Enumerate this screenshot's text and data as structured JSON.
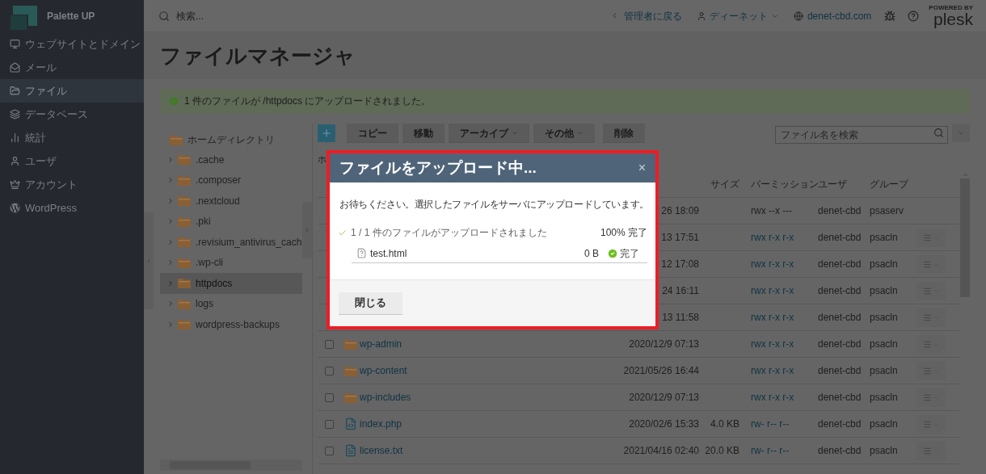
{
  "sidebar": {
    "brand": "Palette UP",
    "items": [
      {
        "label": "ウェブサイトとドメイン",
        "selected": false
      },
      {
        "label": "メール",
        "selected": false
      },
      {
        "label": "ファイル",
        "selected": true
      },
      {
        "label": "データベース",
        "selected": false
      },
      {
        "label": "統計",
        "selected": false
      },
      {
        "label": "ユーザ",
        "selected": false
      },
      {
        "label": "アカウント",
        "selected": false
      },
      {
        "label": "WordPress",
        "selected": false
      }
    ]
  },
  "header": {
    "search_placeholder": "検索...",
    "back": "管理者に戻る",
    "user": "ディーネット",
    "domain": "denet-cbd.com",
    "powered_by": "POWERED BY",
    "logo": "plesk"
  },
  "title": "ファイルマネージャ",
  "banner": "1 件のファイルが /httpdocs にアップロードされました。",
  "tree": {
    "root": "ホームディレクトリ",
    "children": [
      {
        "label": ".cache",
        "selected": false
      },
      {
        "label": ".composer",
        "selected": false
      },
      {
        "label": ".nextcloud",
        "selected": false
      },
      {
        "label": ".pki",
        "selected": false
      },
      {
        "label": ".revisium_antivirus_cach",
        "selected": false
      },
      {
        "label": ".wp-cli",
        "selected": false
      },
      {
        "label": "httpdocs",
        "selected": true
      },
      {
        "label": "logs",
        "selected": false
      },
      {
        "label": "wordpress-backups",
        "selected": false
      }
    ]
  },
  "toolbar": {
    "buttons": [
      {
        "label": "コピー",
        "dropdown": false
      },
      {
        "label": "移動",
        "dropdown": false
      },
      {
        "label": "アーカイブ",
        "dropdown": true
      },
      {
        "label": "その他",
        "dropdown": true
      },
      {
        "label": "削除",
        "dropdown": false
      }
    ],
    "search_placeholder": "ファイル名を検索"
  },
  "breadcrumb": "ホ",
  "table": {
    "columns": [
      "サイズ",
      "パーミッション",
      "ユーザ",
      "グループ"
    ],
    "rows": [
      {
        "modified": "26 18:09",
        "permissions": "rwx --x ---",
        "perm_link": false,
        "user": "denet-cbd",
        "group": "psaserv",
        "actions": false
      },
      {
        "modified": "13 17:51",
        "permissions": "rwx r-x r-x",
        "perm_link": true,
        "user": "denet-cbd",
        "group": "psacln",
        "actions": true
      },
      {
        "modified": "12 17:08",
        "permissions": "rwx r-x r-x",
        "perm_link": true,
        "user": "denet-cbd",
        "group": "psacln",
        "actions": true
      },
      {
        "modified": "24 16:11",
        "permissions": "rwx r-x r-x",
        "perm_link": true,
        "user": "denet-cbd",
        "group": "psacln",
        "actions": true
      },
      {
        "modified": "13 11:58",
        "permissions": "rwx r-x r-x",
        "perm_link": true,
        "user": "denet-cbd",
        "group": "psacln",
        "actions": true
      },
      {
        "checked": false,
        "name": "wp-admin",
        "kind": "folder",
        "modified": "2020/12/9 07:13",
        "permissions": "rwx r-x r-x",
        "perm_link": true,
        "user": "denet-cbd",
        "group": "psacln",
        "actions": true
      },
      {
        "checked": false,
        "name": "wp-content",
        "kind": "folder",
        "modified": "2021/05/26 16:44",
        "permissions": "rwx r-x r-x",
        "perm_link": true,
        "user": "denet-cbd",
        "group": "psacln",
        "actions": true
      },
      {
        "checked": false,
        "name": "wp-includes",
        "kind": "folder",
        "modified": "2020/12/9 07:13",
        "permissions": "rwx r-x r-x",
        "perm_link": true,
        "user": "denet-cbd",
        "group": "psacln",
        "actions": true
      },
      {
        "checked": false,
        "name": "index.php",
        "kind": "code",
        "modified": "2020/02/6 15:33",
        "size": "4.0 KB",
        "permissions": "rw- r-- r--",
        "perm_link": true,
        "user": "denet-cbd",
        "group": "psacln",
        "actions": true
      },
      {
        "checked": false,
        "name": "license.txt",
        "kind": "text",
        "modified": "2021/04/16 02:40",
        "size": "20.0 KB",
        "permissions": "rw- r-- r--",
        "perm_link": true,
        "user": "denet-cbd",
        "group": "psacln",
        "actions": true
      }
    ]
  },
  "modal": {
    "title": "ファイルをアップロード中...",
    "close": "×",
    "message": "お待ちください。選択したファイルをサーバにアップロードしています。",
    "summary": "1 / 1 件のファイルがアップロードされました",
    "percent": "100% 完了",
    "file": {
      "name": "test.html",
      "size": "0 B",
      "status": "完了",
      "done": true
    },
    "button": "閉じる"
  }
}
